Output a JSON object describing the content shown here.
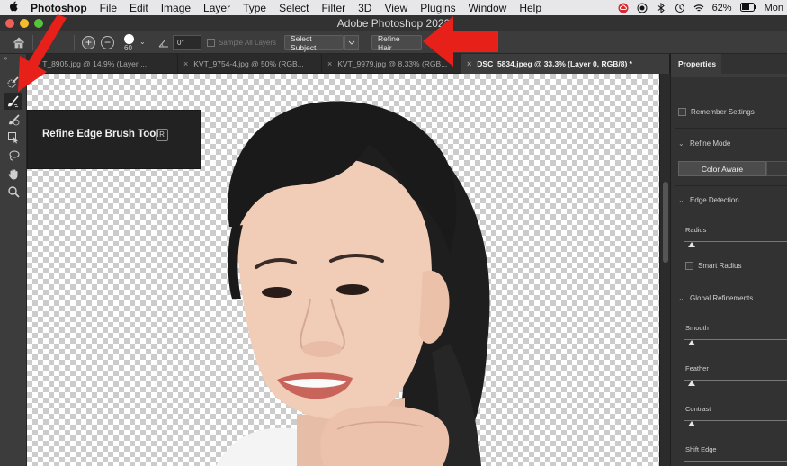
{
  "menubar": {
    "app_name": "Photoshop",
    "items": [
      "File",
      "Edit",
      "Image",
      "Layer",
      "Type",
      "Select",
      "Filter",
      "3D",
      "View",
      "Plugins",
      "Window",
      "Help"
    ],
    "battery": "62%",
    "clock": "Mon"
  },
  "window": {
    "title": "Adobe Photoshop 2022"
  },
  "options_bar": {
    "brush_size": "60",
    "angle": "0°",
    "sample_all_layers": "Sample All Layers",
    "select_subject": "Select Subject",
    "refine_hair": "Refine Hair"
  },
  "tooltip": {
    "text": "Refine Edge Brush Tool",
    "shortcut": "R"
  },
  "tabs": [
    {
      "label": "T_8905.jpg @ 14.9% (Layer ..."
    },
    {
      "label": "KVT_9754-4.jpg @ 50% (RGB..."
    },
    {
      "label": "KVT_9979.jpg @ 8.33% (RGB..."
    },
    {
      "label": "DSC_5834.jpeg @ 33.3% (Layer 0, RGB/8) *"
    }
  ],
  "properties": {
    "title": "Properties",
    "remember": "Remember Settings",
    "refine_mode": "Refine Mode",
    "color_aware": "Color Aware",
    "edge_detection": "Edge Detection",
    "radius": "Radius",
    "smart_radius": "Smart Radius",
    "global_refinements": "Global Refinements",
    "smooth": "Smooth",
    "feather": "Feather",
    "contrast": "Contrast",
    "shift_edge": "Shift Edge"
  },
  "colors": {
    "annotation_arrow": "#e8201a",
    "panel": "#323232",
    "accent_red": "#ee5f57"
  },
  "icons": [
    "apple-icon",
    "home-icon",
    "add-icon",
    "subtract-icon",
    "angle-icon",
    "quick-selection-icon",
    "refine-edge-brush-icon",
    "brush-icon",
    "object-selection-icon",
    "lasso-icon",
    "hand-icon",
    "zoom-icon"
  ]
}
